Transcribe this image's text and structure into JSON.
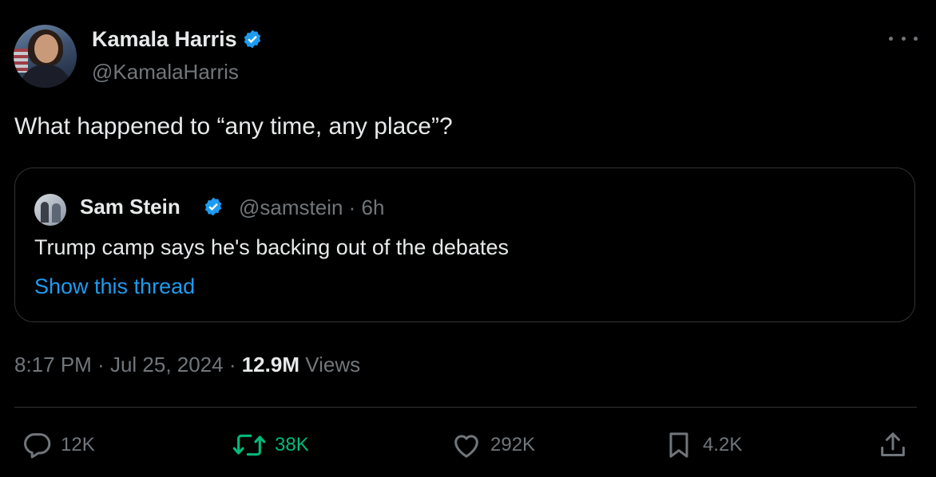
{
  "author": {
    "name": "Kamala Harris",
    "handle": "@KamalaHarris"
  },
  "tweet": {
    "text": "What happened to “any time, any place”?",
    "time": "8:17 PM",
    "separator1": " · ",
    "date": "Jul 25, 2024",
    "separator2": " · ",
    "views_count": "12.9M",
    "views_label": " Views"
  },
  "quoted": {
    "name": "Sam Stein",
    "handle_and_age": "@samstein · 6h",
    "text": "Trump camp says he's backing out of the debates",
    "show_thread": "Show this thread"
  },
  "actions": {
    "replies": "12K",
    "reposts": "38K",
    "likes": "292K",
    "bookmarks": "4.2K"
  },
  "colors": {
    "background": "#000000",
    "text": "#e7e9ea",
    "muted": "#71767b",
    "link": "#1d9bf0",
    "verified_badge": "#1d9bf0",
    "repost_active": "#00ba7c",
    "border": "#2f3336"
  },
  "icons": {
    "more": "more-horizontal-icon",
    "verified": "verified-badge-icon",
    "reply": "reply-bubble-icon",
    "repost": "repost-arrows-icon",
    "like": "heart-icon",
    "bookmark": "bookmark-icon",
    "share": "share-upload-icon"
  }
}
